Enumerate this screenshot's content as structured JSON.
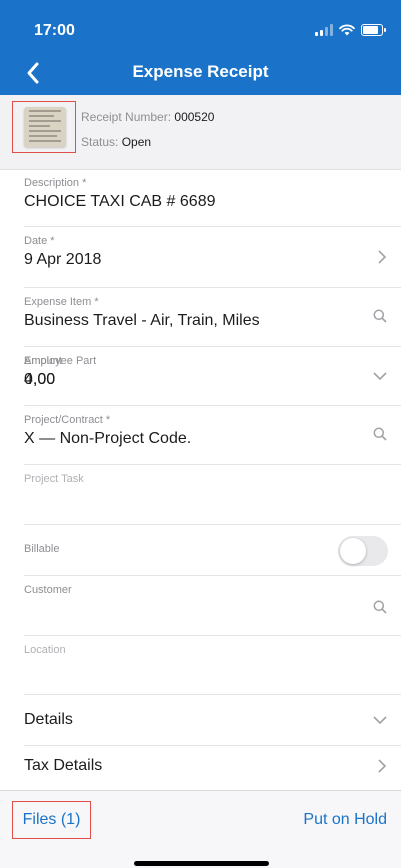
{
  "status_bar": {
    "time": "17:00"
  },
  "nav": {
    "title": "Expense Receipt"
  },
  "receipt": {
    "number_label": "Receipt Number:",
    "number": "000520",
    "status_label": "Status:",
    "status": "Open"
  },
  "form": {
    "description": {
      "label": "Description *",
      "value": "CHOICE TAXI CAB # 6689"
    },
    "date": {
      "label": "Date *",
      "value": "9 Apr 2018"
    },
    "expense_item": {
      "label": "Expense Item *",
      "value": "Business Travel - Air, Train, Miles"
    },
    "amount": {
      "label": "Amount",
      "value": "4,00"
    },
    "employee_part": {
      "label": "Employee Part",
      "value": "0,00"
    },
    "project_contract": {
      "label": "Project/Contract *",
      "value": "X — Non-Project Code."
    },
    "project_task": {
      "label": "Project Task",
      "value": ""
    },
    "billable": {
      "label": "Billable",
      "on": false
    },
    "customer": {
      "label": "Customer",
      "value": ""
    },
    "location": {
      "label": "Location",
      "value": ""
    }
  },
  "sections": {
    "details": "Details",
    "tax_details": "Tax Details"
  },
  "footer": {
    "files": "Files (1)",
    "hold": "Put on Hold"
  },
  "colors": {
    "brand": "#1a73c8",
    "highlight": "#e0504a"
  }
}
